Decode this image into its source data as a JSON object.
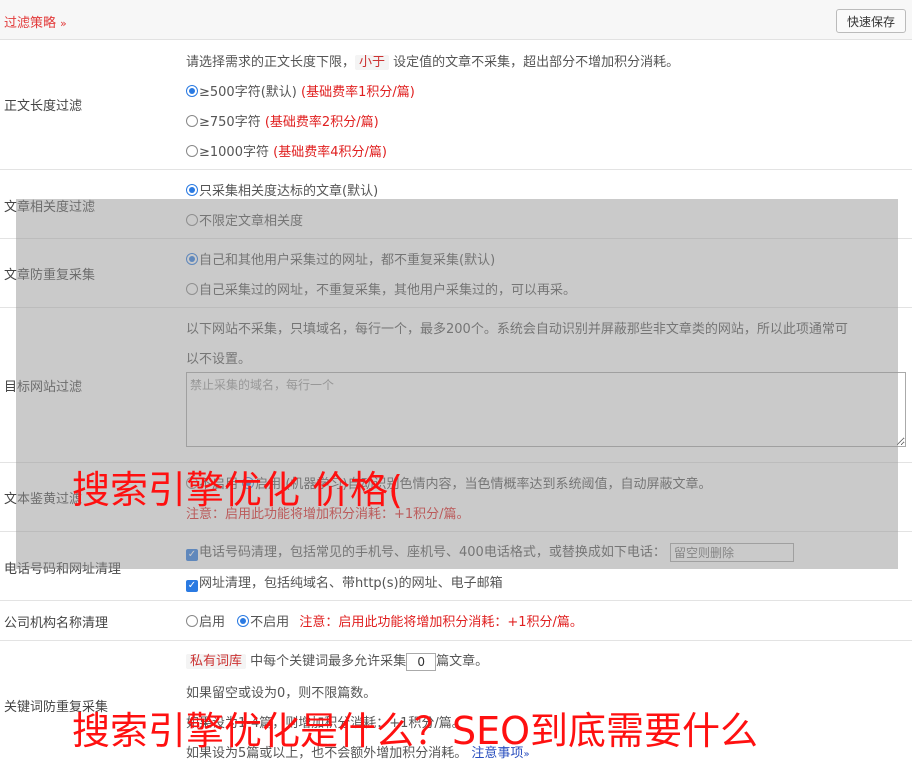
{
  "header": {
    "title": "过滤策略",
    "chevron": "»",
    "save_label": "快速保存"
  },
  "length_filter": {
    "label": "正文长度过滤",
    "desc_prefix": "请选择需求的正文长度下限，",
    "desc_tag": "小于",
    "desc_suffix": "设定值的文章不采集，超出部分不增加积分消耗。",
    "options": [
      {
        "text": "≥500字符(默认)",
        "note": "(基础费率1积分/篇)",
        "selected": true
      },
      {
        "text": "≥750字符",
        "note": "(基础费率2积分/篇)",
        "selected": false
      },
      {
        "text": "≥1000字符",
        "note": "(基础费率4积分/篇)",
        "selected": false
      }
    ]
  },
  "relevance_filter": {
    "label": "文章相关度过滤",
    "options": [
      {
        "text": "只采集相关度达标的文章(默认)",
        "selected": true
      },
      {
        "text": "不限定文章相关度",
        "selected": false
      }
    ]
  },
  "dedup_filter": {
    "label": "文章防重复采集",
    "options": [
      {
        "text": "自己和其他用户采集过的网址，都不重复采集(默认)",
        "selected": true
      },
      {
        "text": "自己采集过的网址，不重复采集，其他用户采集过的，可以再采。",
        "selected": false
      }
    ]
  },
  "site_filter": {
    "label": "目标网站过滤",
    "desc_line1": "以下网站不采集，只填域名，每行一个，最多200个。系统会自动识别并屏蔽那些非文章类的网站，所以此项通常可",
    "desc_line2": "以不设置。",
    "placeholder": "禁止采集的域名，每行一个"
  },
  "porn_filter": {
    "label": "文本鉴黄过滤",
    "opt_off": "不启用",
    "opt_on": "启用",
    "desc": "(机器学习)自动识别色情内容，当色情概率达到系统阈值，自动屏蔽文章。",
    "note": "注意：启用此功能将增加积分消耗：+1积分/篇。"
  },
  "contact_clean": {
    "label": "电话号码和网址清理",
    "phone_text": "电话号码清理，包括常见的手机号、座机号、400电话格式，或替换成如下电话：",
    "phone_placeholder": "留空则删除",
    "url_text": "网址清理，包括纯域名、带http(s)的网址、电子邮箱"
  },
  "org_clean": {
    "label": "公司机构名称清理",
    "opt_on": "启用",
    "opt_off": "不启用",
    "note": "注意：启用此功能将增加积分消耗：+1积分/篇。"
  },
  "keyword_dedup": {
    "label": "关键词防重复采集",
    "tag": "私有词库",
    "text_before": "中每个关键词最多允许采集",
    "value": "0",
    "text_after": "篇文章。",
    "line2": "如果留空或设为0，则不限篇数。",
    "line3_prefix": "如果设为1-4篇，则增加积分消耗：+",
    "line3_value": "1积分/篇。",
    "line4": "如果设为5篇或以上，也不会额外增加积分消耗。",
    "link": "注意事项"
  },
  "watermarks": {
    "line1": "搜索引擎优化 价格(",
    "line2": "搜索引擎优化是什么？SEO到底需要什么"
  },
  "colors": {
    "accent_red": "#e02020",
    "radio_blue": "#2a7ae2",
    "link_blue": "#2a4fbf"
  }
}
